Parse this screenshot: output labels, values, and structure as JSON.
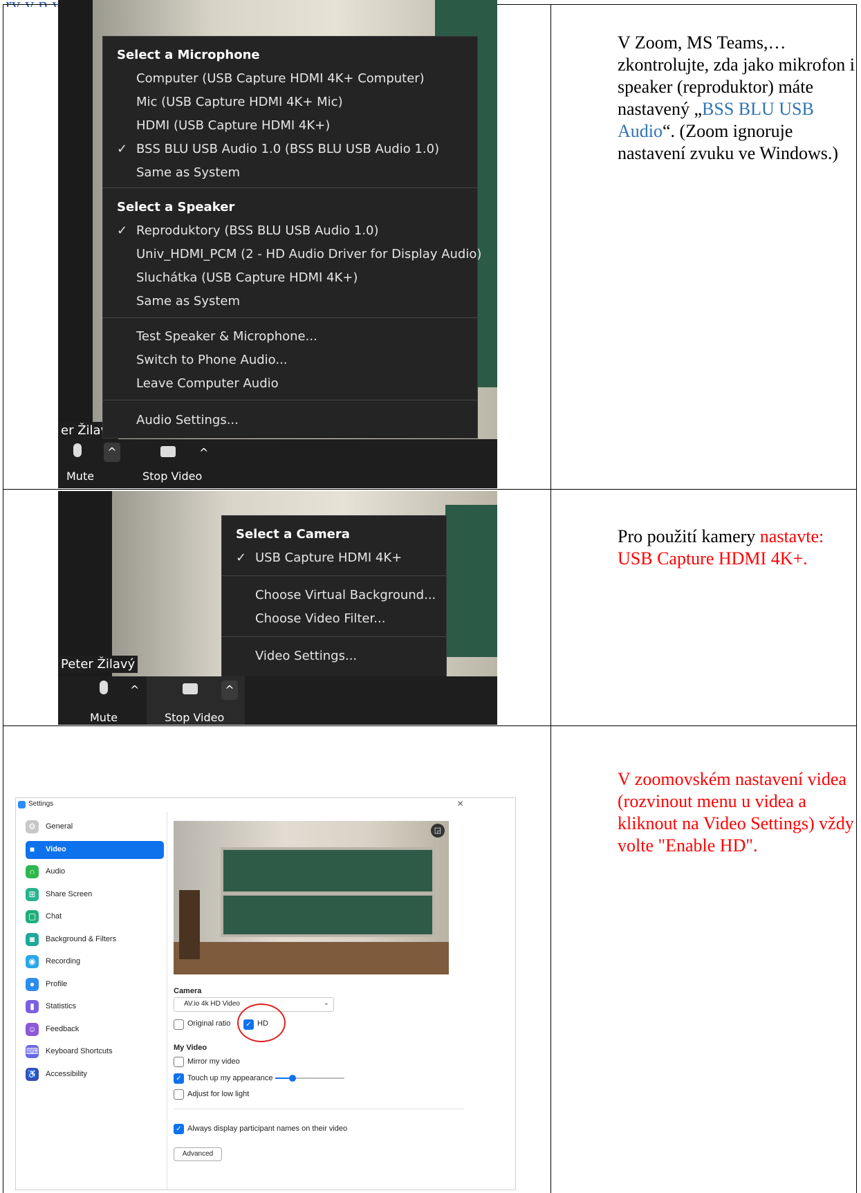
{
  "top_clip_text": "ry v p yp",
  "row1": {
    "note_parts": [
      "V Zoom, MS Teams,… zkontrolujte, zda jako mikrofon i speaker (reproduktor) máte nastavený „",
      "BSS BLU USB Audio",
      "“. (Zoom ignoruje nastavení zvuku ve Windows.)"
    ],
    "menu": {
      "mic_header": "Select a Microphone",
      "mic_items": [
        "Computer (USB Capture HDMI 4K+ Computer)",
        "Mic (USB Capture HDMI 4K+ Mic)",
        "HDMI (USB Capture HDMI 4K+)",
        "BSS BLU USB Audio 1.0  (BSS BLU USB Audio 1.0)",
        "Same as System"
      ],
      "mic_checked_index": 3,
      "speaker_header": "Select a Speaker",
      "speaker_items": [
        "Reproduktory (BSS BLU USB Audio 1.0)",
        "Univ_HDMI_PCM (2 - HD Audio Driver for Display Audio)",
        "Sluchátka (USB Capture HDMI 4K+)",
        "Same as System"
      ],
      "speaker_checked_index": 0,
      "actions": [
        "Test Speaker & Microphone...",
        "Switch to Phone Audio...",
        "Leave Computer Audio"
      ],
      "settings_item": "Audio Settings...",
      "check_mark": "✓"
    },
    "name_tag": "er Žilavý",
    "mute_label": "Mute",
    "stop_video_label": "Stop Video"
  },
  "row2": {
    "note_black": "Pro použití kamery ",
    "note_red": "nastavte: USB Capture HDMI 4K+.",
    "menu": {
      "camera_header": "Select a Camera",
      "camera_item": "USB Capture HDMI 4K+",
      "check_mark": "✓",
      "actions": [
        "Choose Virtual Background...",
        "Choose Video Filter..."
      ],
      "settings_item": "Video Settings..."
    },
    "name_tag": "Peter Žilavý",
    "mute_label": "Mute",
    "stop_video_label": "Stop Video"
  },
  "row3": {
    "note": "V zoomovském nastavení videa (rozvinout menu u videa a kliknout na Video Settings) vždy volte \"Enable HD\".",
    "settings": {
      "window_title": "Settings",
      "close_glyph": "×",
      "sidebar": [
        {
          "label": "General",
          "icon": "gear-icon",
          "color": "#c8c8c8",
          "glyph": "⚙"
        },
        {
          "label": "Video",
          "icon": "video-icon",
          "color": "#ffffff",
          "glyph": "■"
        },
        {
          "label": "Audio",
          "icon": "headphones-icon",
          "color": "#2db84d",
          "glyph": "∩"
        },
        {
          "label": "Share Screen",
          "icon": "share-screen-icon",
          "color": "#28b28f",
          "glyph": "⊞"
        },
        {
          "label": "Chat",
          "icon": "chat-icon",
          "color": "#1fae7b",
          "glyph": "▢"
        },
        {
          "label": "Background & Filters",
          "icon": "background-icon",
          "color": "#20a99b",
          "glyph": "◙"
        },
        {
          "label": "Recording",
          "icon": "recording-icon",
          "color": "#2aa6e8",
          "glyph": "◉"
        },
        {
          "label": "Profile",
          "icon": "profile-icon",
          "color": "#2d8cf0",
          "glyph": "●"
        },
        {
          "label": "Statistics",
          "icon": "statistics-icon",
          "color": "#7a5fe0",
          "glyph": "▮"
        },
        {
          "label": "Feedback",
          "icon": "feedback-icon",
          "color": "#8c57d8",
          "glyph": "☺"
        },
        {
          "label": "Keyboard Shortcuts",
          "icon": "keyboard-icon",
          "color": "#6a67e6",
          "glyph": "⌨"
        },
        {
          "label": "Accessibility",
          "icon": "accessibility-icon",
          "color": "#3c4bb3",
          "glyph": "♿"
        }
      ],
      "active_index": 1,
      "camera_label": "Camera",
      "camera_value": "AV.io 4k HD Video",
      "original_ratio_label": "Original ratio",
      "original_ratio_checked": false,
      "hd_label": "HD",
      "hd_checked": true,
      "my_video_label": "My Video",
      "mirror_label": "Mirror my video",
      "mirror_checked": false,
      "touch_up_label": "Touch up my appearance",
      "touch_up_checked": true,
      "touch_up_level": 0.25,
      "low_light_label": "Adjust for low light",
      "low_light_checked": false,
      "display_names_label": "Always display participant names on their video",
      "display_names_checked": true,
      "advanced_label": "Advanced"
    }
  }
}
